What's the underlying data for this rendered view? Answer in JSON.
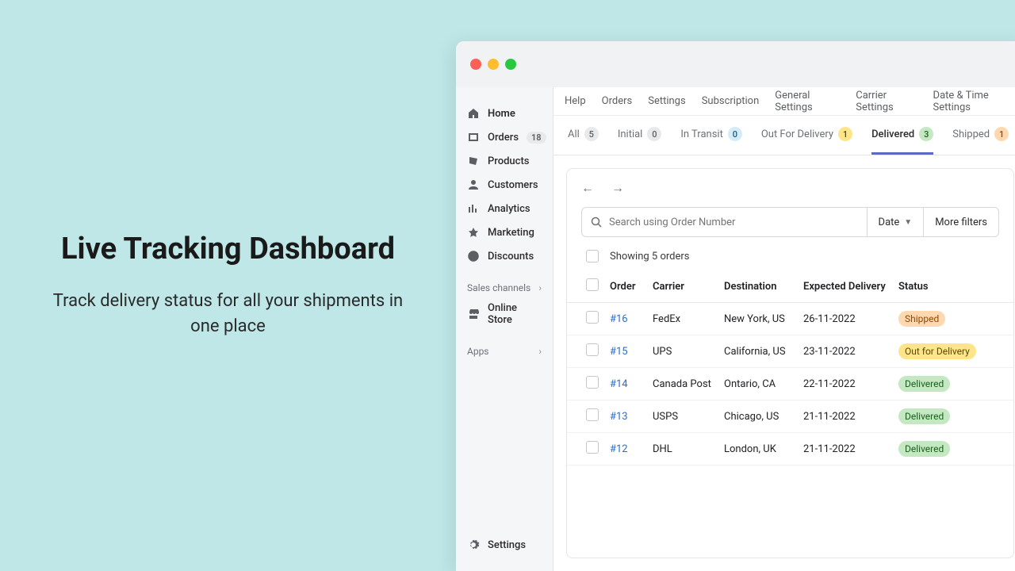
{
  "hero": {
    "title": "Live Tracking Dashboard",
    "subtitle": "Track delivery status for all your shipments in one place"
  },
  "sidebar": {
    "items": [
      {
        "label": "Home"
      },
      {
        "label": "Orders",
        "badge": "18"
      },
      {
        "label": "Products"
      },
      {
        "label": "Customers"
      },
      {
        "label": "Analytics"
      },
      {
        "label": "Marketing"
      },
      {
        "label": "Discounts"
      }
    ],
    "sales_channels_label": "Sales channels",
    "online_store_label": "Online Store",
    "apps_label": "Apps",
    "settings_label": "Settings"
  },
  "topnav": [
    "Help",
    "Orders",
    "Settings",
    "Subscription",
    "General Settings",
    "Carrier Settings",
    "Date & Time Settings"
  ],
  "tabs": [
    {
      "label": "All",
      "count": "5",
      "color": "gray"
    },
    {
      "label": "Initial",
      "count": "0",
      "color": "gray"
    },
    {
      "label": "In Transit",
      "count": "0",
      "color": "blue"
    },
    {
      "label": "Out For Delivery",
      "count": "1",
      "color": "yellow"
    },
    {
      "label": "Delivered",
      "count": "3",
      "color": "green"
    },
    {
      "label": "Shipped",
      "count": "1",
      "color": "orange"
    }
  ],
  "active_tab": 4,
  "search": {
    "placeholder": "Search using Order Number"
  },
  "filters": {
    "date": "Date",
    "more": "More filters"
  },
  "showing_text": "Showing 5 orders",
  "columns": {
    "order": "Order",
    "carrier": "Carrier",
    "dest": "Destination",
    "exp": "Expected Delivery",
    "status": "Status"
  },
  "rows": [
    {
      "order": "#16",
      "carrier": "FedEx",
      "dest": "New York, US",
      "exp": "26-11-2022",
      "status": "Shipped",
      "status_class": "st-shipped"
    },
    {
      "order": "#15",
      "carrier": "UPS",
      "dest": "California, US",
      "exp": "23-11-2022",
      "status": "Out for Delivery",
      "status_class": "st-out"
    },
    {
      "order": "#14",
      "carrier": "Canada Post",
      "dest": "Ontario, CA",
      "exp": "22-11-2022",
      "status": "Delivered",
      "status_class": "st-delivered"
    },
    {
      "order": "#13",
      "carrier": "USPS",
      "dest": "Chicago, US",
      "exp": "21-11-2022",
      "status": "Delivered",
      "status_class": "st-delivered"
    },
    {
      "order": "#12",
      "carrier": "DHL",
      "dest": "London, UK",
      "exp": "21-11-2022",
      "status": "Delivered",
      "status_class": "st-delivered"
    }
  ]
}
